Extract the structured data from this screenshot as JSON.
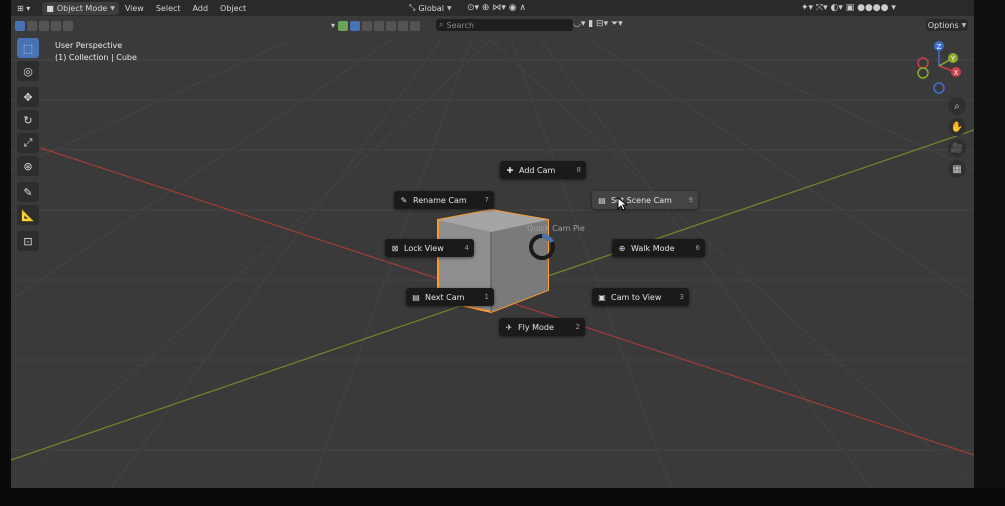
{
  "header": {
    "mode": "Object Mode",
    "menus": [
      "View",
      "Select",
      "Add",
      "Object"
    ],
    "transform": "Global",
    "search_placeholder": "Search",
    "options": "Options"
  },
  "overlay": {
    "perspective": "User Perspective",
    "collection": "(1) Collection | Cube"
  },
  "axes": {
    "x": "X",
    "y": "Y",
    "z": "Z"
  },
  "pie": {
    "title": "Quick Cam Pie",
    "items": [
      {
        "label": "Add Cam",
        "key": "8"
      },
      {
        "label": "Rename Cam",
        "key": "7"
      },
      {
        "label": "Set Scene Cam",
        "key": "9"
      },
      {
        "label": "Lock View",
        "key": "4"
      },
      {
        "label": "Walk Mode",
        "key": "6"
      },
      {
        "label": "Next Cam",
        "key": "1"
      },
      {
        "label": "Cam to View",
        "key": "3"
      },
      {
        "label": "Fly Mode",
        "key": "2"
      }
    ]
  },
  "colors": {
    "accent": "#4772b3",
    "cube_outline": "#ff9a2c",
    "x_axis": "#a33a3a",
    "y_axis": "#6e8a2a",
    "grid": "#474747",
    "viewport_bg": "#3a3a3a"
  }
}
